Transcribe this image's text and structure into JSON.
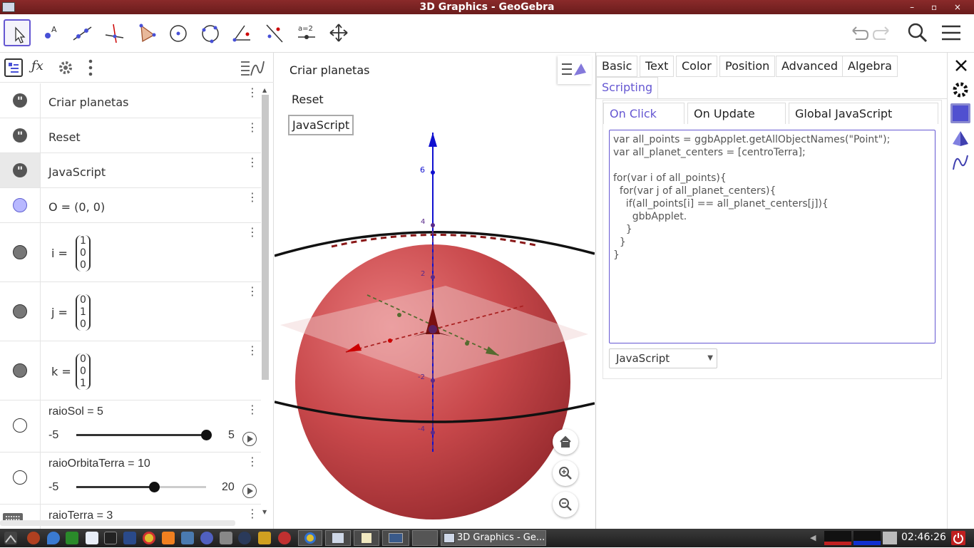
{
  "window": {
    "title": "3D Graphics - GeoGebra",
    "controls": "– ▫ ×"
  },
  "algebra": {
    "rows": [
      {
        "type": "text",
        "label": "Criar planetas"
      },
      {
        "type": "text",
        "label": "Reset"
      },
      {
        "type": "text",
        "label": "JavaScript"
      },
      {
        "type": "point",
        "label": "O = (0, 0)"
      },
      {
        "type": "vector",
        "name": "i =",
        "values": [
          "1",
          "0",
          "0"
        ]
      },
      {
        "type": "vector",
        "name": "j =",
        "values": [
          "0",
          "1",
          "0"
        ]
      },
      {
        "type": "vector",
        "name": "k =",
        "values": [
          "0",
          "0",
          "1"
        ]
      },
      {
        "type": "slider",
        "label": "raioSol = 5",
        "min": "-5",
        "max": "5",
        "value": 5,
        "fraction": 1.0
      },
      {
        "type": "slider",
        "label": "raioOrbitaTerra = 10",
        "min": "-5",
        "max": "20",
        "value": 10,
        "fraction": 0.6
      },
      {
        "type": "slider",
        "label": "raioTerra = 3"
      }
    ]
  },
  "graphics": {
    "buttons": [
      "Criar planetas",
      "Reset",
      "JavaScript"
    ],
    "axis_ticks": [
      "6",
      "4",
      "2",
      "-2",
      "-4"
    ],
    "colors": {
      "sphere": "#c8484b",
      "zaxis": "#1010d0",
      "xaxis": "#cc0000",
      "yaxis": "#556b2f"
    }
  },
  "properties": {
    "tabs": [
      "Basic",
      "Text",
      "Color",
      "Position",
      "Advanced",
      "Algebra"
    ],
    "tab_row2": "Scripting",
    "script_tabs": [
      "On Click",
      "On Update",
      "Global JavaScript"
    ],
    "code_lines": [
      "var all_points = ggbApplet.getAllObjectNames(\"Point\");",
      "var all_planet_centers = [centroTerra];",
      "",
      "for(var i of all_points){",
      "  for(var j of all_planet_centers){",
      "    if(all_points[i] == all_planet_centers[j]){",
      "      gbbApplet.",
      "    }",
      "  }",
      "}"
    ],
    "language": "JavaScript"
  },
  "taskbar": {
    "active_task": "3D Graphics - Ge...",
    "clock": "02:46:26"
  },
  "accent": "#6557d2"
}
